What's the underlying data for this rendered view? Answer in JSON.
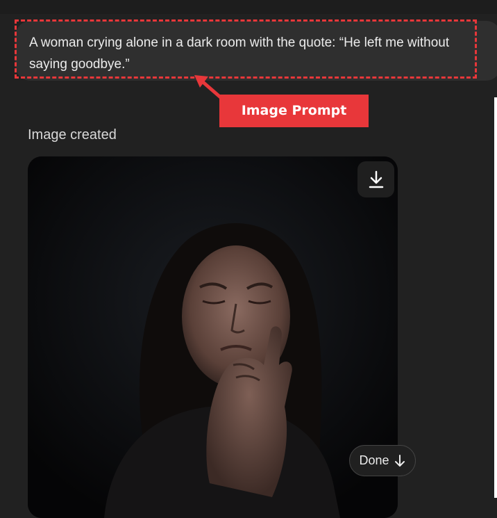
{
  "chat": {
    "prompt": "A woman crying alone in a dark room with the quote: “He left me without saying goodbye.”",
    "status": "Image created"
  },
  "annotation": {
    "label": "Image Prompt",
    "color": "#e8373a"
  },
  "image": {
    "description_icon": "generated-image",
    "download_icon": "download-icon"
  },
  "scroll_pill": {
    "label": "Done",
    "icon": "arrow-down-icon"
  }
}
